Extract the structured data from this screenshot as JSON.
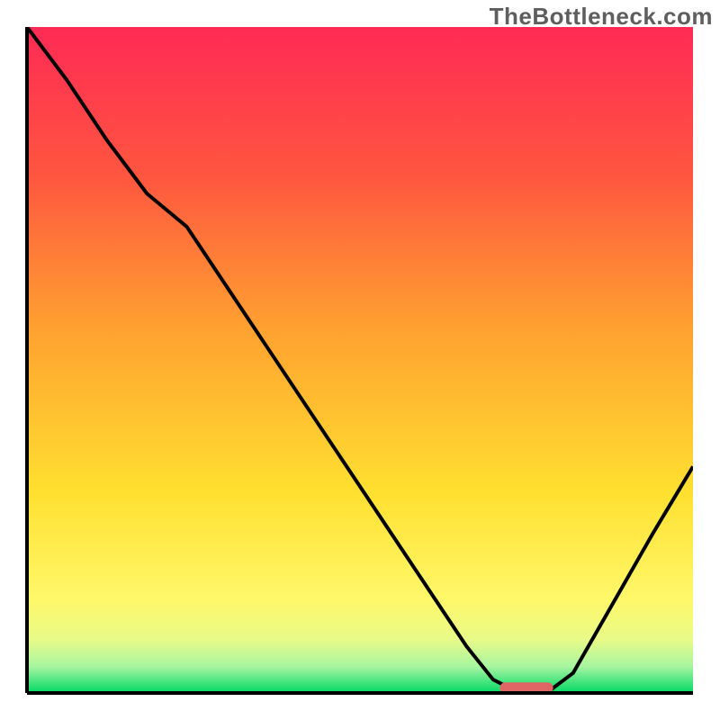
{
  "watermark": "TheBottleneck.com",
  "chart_data": {
    "type": "line",
    "title": "",
    "xlabel": "",
    "ylabel": "",
    "xlim": [
      0,
      100
    ],
    "ylim": [
      0,
      100
    ],
    "background_gradient": {
      "stops": [
        {
          "pct": 0.0,
          "color": "#ff2a55"
        },
        {
          "pct": 0.22,
          "color": "#ff5540"
        },
        {
          "pct": 0.45,
          "color": "#ffa030"
        },
        {
          "pct": 0.7,
          "color": "#ffe030"
        },
        {
          "pct": 0.86,
          "color": "#fff86a"
        },
        {
          "pct": 0.92,
          "color": "#e8fb88"
        },
        {
          "pct": 0.96,
          "color": "#a8f5a0"
        },
        {
          "pct": 1.0,
          "color": "#00d964"
        }
      ]
    },
    "series": [
      {
        "name": "bottleneck-curve",
        "color": "#000000",
        "x": [
          0,
          6,
          12,
          18,
          24,
          30,
          36,
          42,
          48,
          54,
          60,
          66,
          70,
          74,
          78,
          82,
          86,
          90,
          94,
          100
        ],
        "values": [
          100,
          92,
          83,
          75,
          70,
          61,
          52,
          43,
          34,
          25,
          16,
          7,
          2,
          0,
          0,
          3,
          10,
          17,
          24,
          34
        ]
      }
    ],
    "marker": {
      "name": "optimal-zone-marker",
      "color": "#e06666",
      "x_center": 75,
      "y": 0.8,
      "width": 8,
      "height": 1.6
    },
    "axes_color": "#000000",
    "axes_width": 4
  }
}
